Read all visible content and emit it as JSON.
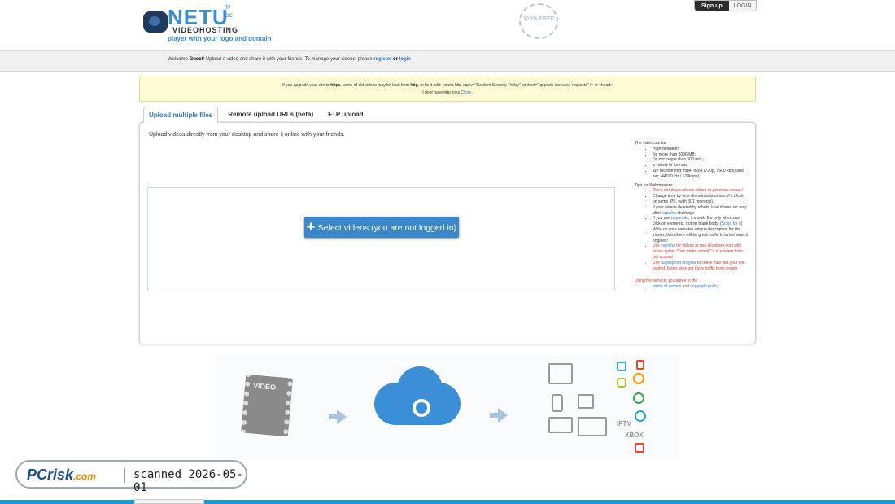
{
  "header": {
    "logo_text": "NETU",
    "logo_tld": ".tv .ac",
    "logo_sub": "VIDEOHOSTING",
    "tagline": "player with your logo and domain",
    "badge_text": "100% FREE",
    "signup_label": "Sign up",
    "login_label": "LOGIN"
  },
  "welcome": {
    "prefix": "Welcome ",
    "user": "Guest",
    "middle": "! Upload a video and share it with your friends. To manage your videos, please ",
    "register_link": "register",
    "or": " or ",
    "login_link": "login"
  },
  "notice": {
    "line1_a": "If you upgrade your site to ",
    "line1_https": "https",
    "line1_b": ", some of old videos may be load from ",
    "line1_http": "http",
    "line1_c": ", to fix it add: <meta http-equiv=\"Content-Security-Policy\" content=\"upgrade-insecure-requests\" /> in <head>",
    "line2_a": "I dont have http links ",
    "close_link": "Close",
    "line2_b": "."
  },
  "tabs": [
    {
      "label": "Upload multiple files"
    },
    {
      "label": "Remote upload URLs (beta)"
    },
    {
      "label": "FTP upload"
    }
  ],
  "upload": {
    "description": "Upload videos directly from your desktop and share it online with your friends.",
    "select_button": "Select videos (you are not logged in)"
  },
  "tips": {
    "video_heading": "The video can be:",
    "video_items": [
      "High-definition;",
      "No more than 8096 MB;",
      "Do not longer than 500 min.;",
      "a variety of formats;",
      "We recommend: mp4, h264 (720p, 1500 kb/s) and aac (44100 Hz / 128kbps);"
    ],
    "webmaster_heading": "Tips for Webmasters:",
    "w1": "Place our player above others to get more money!",
    "w2": "Change time by time domain/subdomain, if it block on some IPS. (with 301 redirects)",
    "w3_a": "If your videos deleted by robots, load iframe src only after ",
    "w3_link": "captcha",
    "w3_b": " challenge",
    "w4_a": "If you use ",
    "w4_link": "popunder",
    "w4_b": ", it should fire only when user click on elements, not on blank body. (",
    "w4_link2": "Script for it",
    "w4_c": ")",
    "w5": "Write on your websites unique description for the videos, then there will be great traffic from the search engines!",
    "w6_a": "Use ",
    "w6_link": "captcha",
    "w6_b": " for videos or use cloudfare.com with active option \"I'am under attack!\" it is prevent from bot access!",
    "w7_a": "Use ",
    "w7_link": "pagespeed insights",
    "w7_b": " to check how fast your site loaded, faster sites got more traffic from google",
    "agree_text": "Using the service, you agree to the",
    "terms_link": "terms of service",
    "and": " and ",
    "copyright_link": "copyright policy"
  },
  "infographic": {
    "film_label": "VIDEO",
    "platforms": [
      "IPTV",
      "XBOX"
    ]
  },
  "pcrisk": {
    "logo": "PCrisk",
    "logo_dot": ".com",
    "scan_text": "scanned 2026-05-01"
  }
}
